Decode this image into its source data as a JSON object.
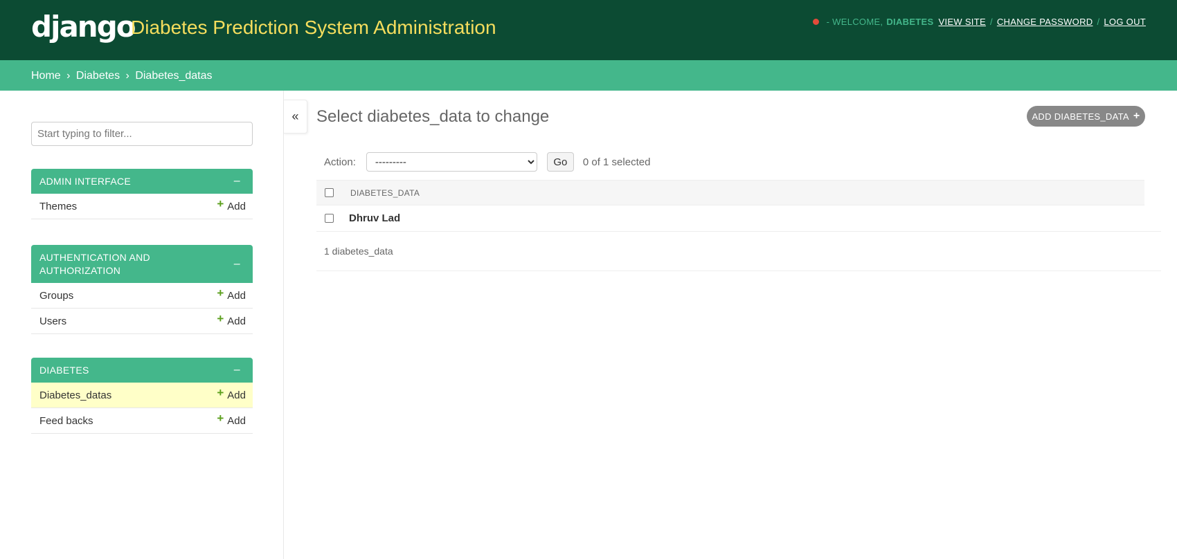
{
  "header": {
    "logo": "django",
    "site_title": "Diabetes Prediction System Administration",
    "welcome": "- WELCOME,",
    "username": "DIABETES",
    "view_site": "VIEW SITE",
    "change_password": "CHANGE PASSWORD",
    "log_out": "LOG OUT",
    "separator": "/"
  },
  "breadcrumbs": {
    "home": "Home",
    "app": "Diabetes",
    "current": "Diabetes_datas",
    "separator": "›"
  },
  "sidebar": {
    "filter_placeholder": "Start typing to filter...",
    "add_label": "Add",
    "collapse_symbol": "–",
    "modules": [
      {
        "title": "ADMIN INTERFACE",
        "items": [
          {
            "name": "Themes"
          }
        ]
      },
      {
        "title_line1": "AUTHENTICATION AND",
        "title_line2": "AUTHORIZATION",
        "items": [
          {
            "name": "Groups"
          },
          {
            "name": "Users"
          }
        ]
      },
      {
        "title": "DIABETES",
        "items": [
          {
            "name": "Diabetes_datas",
            "current": true
          },
          {
            "name": "Feed backs"
          }
        ]
      }
    ]
  },
  "toggle": {
    "symbol": "«"
  },
  "main": {
    "title": "Select diabetes_data to change",
    "add_button": "ADD DIABETES_DATA",
    "action_label": "Action:",
    "action_selected": "---------",
    "go_label": "Go",
    "selected_counter": "0 of 1 selected",
    "column_header": "DIABETES_DATA",
    "rows": [
      {
        "name": "Dhruv Lad"
      }
    ],
    "paginator": "1 diabetes_data"
  },
  "colors": {
    "header_bg": "#0c4b33",
    "accent": "#44b78b",
    "site_title": "#f5dd5d",
    "status_dot": "#e34b3a",
    "current_row": "#ffffc8",
    "add_plus": "#5b9f1c"
  },
  "icons": {
    "status": "status-dot-icon",
    "add": "plus-icon",
    "toggle": "double-chevron-left-icon",
    "select": "chevron-down-icon"
  }
}
